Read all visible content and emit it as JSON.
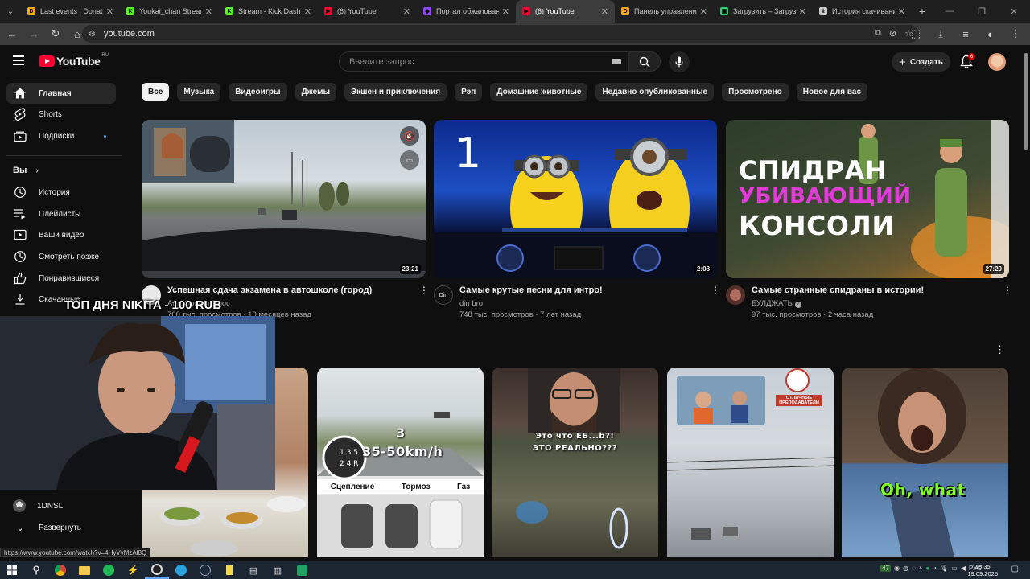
{
  "browser": {
    "tabs": [
      {
        "title": "Last events | DonationAlerts",
        "icon_color": "#f5a623",
        "icon_letter": "D"
      },
      {
        "title": "Youkai_chan Stream",
        "icon_color": "#53fc18",
        "icon_letter": "K"
      },
      {
        "title": "Stream - Kick Dashboard",
        "icon_color": "#53fc18",
        "icon_letter": "K"
      },
      {
        "title": "(6) YouTube",
        "icon_color": "#ff0033",
        "icon_letter": "▶"
      },
      {
        "title": "Портал обжалования",
        "icon_color": "#9146ff",
        "icon_letter": "◆"
      },
      {
        "title": "(6) YouTube",
        "icon_color": "#ff0033",
        "icon_letter": "▶",
        "active": true
      },
      {
        "title": "Панель управления",
        "icon_color": "#f5a623",
        "icon_letter": "D"
      },
      {
        "title": "Загрузить – Загрузить",
        "icon_color": "#2ecc71",
        "icon_letter": "▣"
      },
      {
        "title": "История скачивания",
        "icon_color": "#cccccc",
        "icon_letter": "⤓"
      }
    ],
    "url": "youtube.com",
    "status_url": "https://www.youtube.com/watch?v=4HyVvMzAl8Q"
  },
  "header": {
    "logo_text": "YouTube",
    "logo_region": "RU",
    "search_placeholder": "Введите запрос",
    "create_label": "Создать",
    "notification_count": "6"
  },
  "sidebar": {
    "main": [
      {
        "label": "Главная",
        "icon": "home-icon",
        "active": true
      },
      {
        "label": "Shorts",
        "icon": "shorts-icon"
      },
      {
        "label": "Подписки",
        "icon": "subscriptions-icon",
        "dot": true
      }
    ],
    "you_label": "Вы",
    "you_items": [
      {
        "label": "История",
        "icon": "history-icon"
      },
      {
        "label": "Плейлисты",
        "icon": "playlists-icon"
      },
      {
        "label": "Ваши видео",
        "icon": "your-videos-icon"
      },
      {
        "label": "Смотреть позже",
        "icon": "watch-later-icon"
      },
      {
        "label": "Понравившиеся",
        "icon": "liked-icon"
      },
      {
        "label": "Скачанные",
        "icon": "downloads-icon"
      }
    ],
    "subscription_channel": "1DNSL",
    "expand_label": "Развернуть"
  },
  "chips": [
    "Все",
    "Музыка",
    "Видеоигры",
    "Джемы",
    "Экшен и приключения",
    "Рэп",
    "Домашние животные",
    "Недавно опубликованные",
    "Просмотрено",
    "Новое для вас"
  ],
  "videos": [
    {
      "title": "Успешная сдача экзамена в автошколе (город)",
      "channel": "АвтоОриентПлюс",
      "stats": "760 тыс. просмотров · 10 месяцев назад",
      "duration": "23:21"
    },
    {
      "title": "Самые крутые песни для интро!",
      "channel": "din bro",
      "stats": "748 тыс. просмотров · 7 лет назад",
      "duration": "2:08",
      "thumb_text": "1"
    },
    {
      "title": "Самые странные спидраны в истории!",
      "channel": "БУЛДЖАТЬ",
      "stats": "97 тыс. просмотров · 2 часа назад",
      "duration": "27:20",
      "verified": true,
      "thumb_lines": [
        "СПИДРАН",
        "УБИВАЮЩИЙ",
        "КОНСОЛИ"
      ]
    }
  ],
  "shorts": [
    {
      "overlay_speed": "3",
      "overlay_range": "35-50km/h",
      "pedals": [
        "Сцепление",
        "Тормоз",
        "Газ"
      ]
    },
    {
      "overlay_lines": [
        "Это что ЕБ...b?!",
        "ЭТО РЕАЛЬНО???"
      ]
    },
    {
      "badge": "ОТЛИЧНЫЕ ПРЕПОДАВАТЕЛИ"
    },
    {
      "overlay": "Oh, what"
    }
  ],
  "stream_overlay": {
    "caption": "ТОП ДНЯ NIKITA - 100 RUB"
  },
  "taskbar": {
    "time": "18:35",
    "date": "19.09.2025",
    "lang": "РУС",
    "temp": "47"
  }
}
